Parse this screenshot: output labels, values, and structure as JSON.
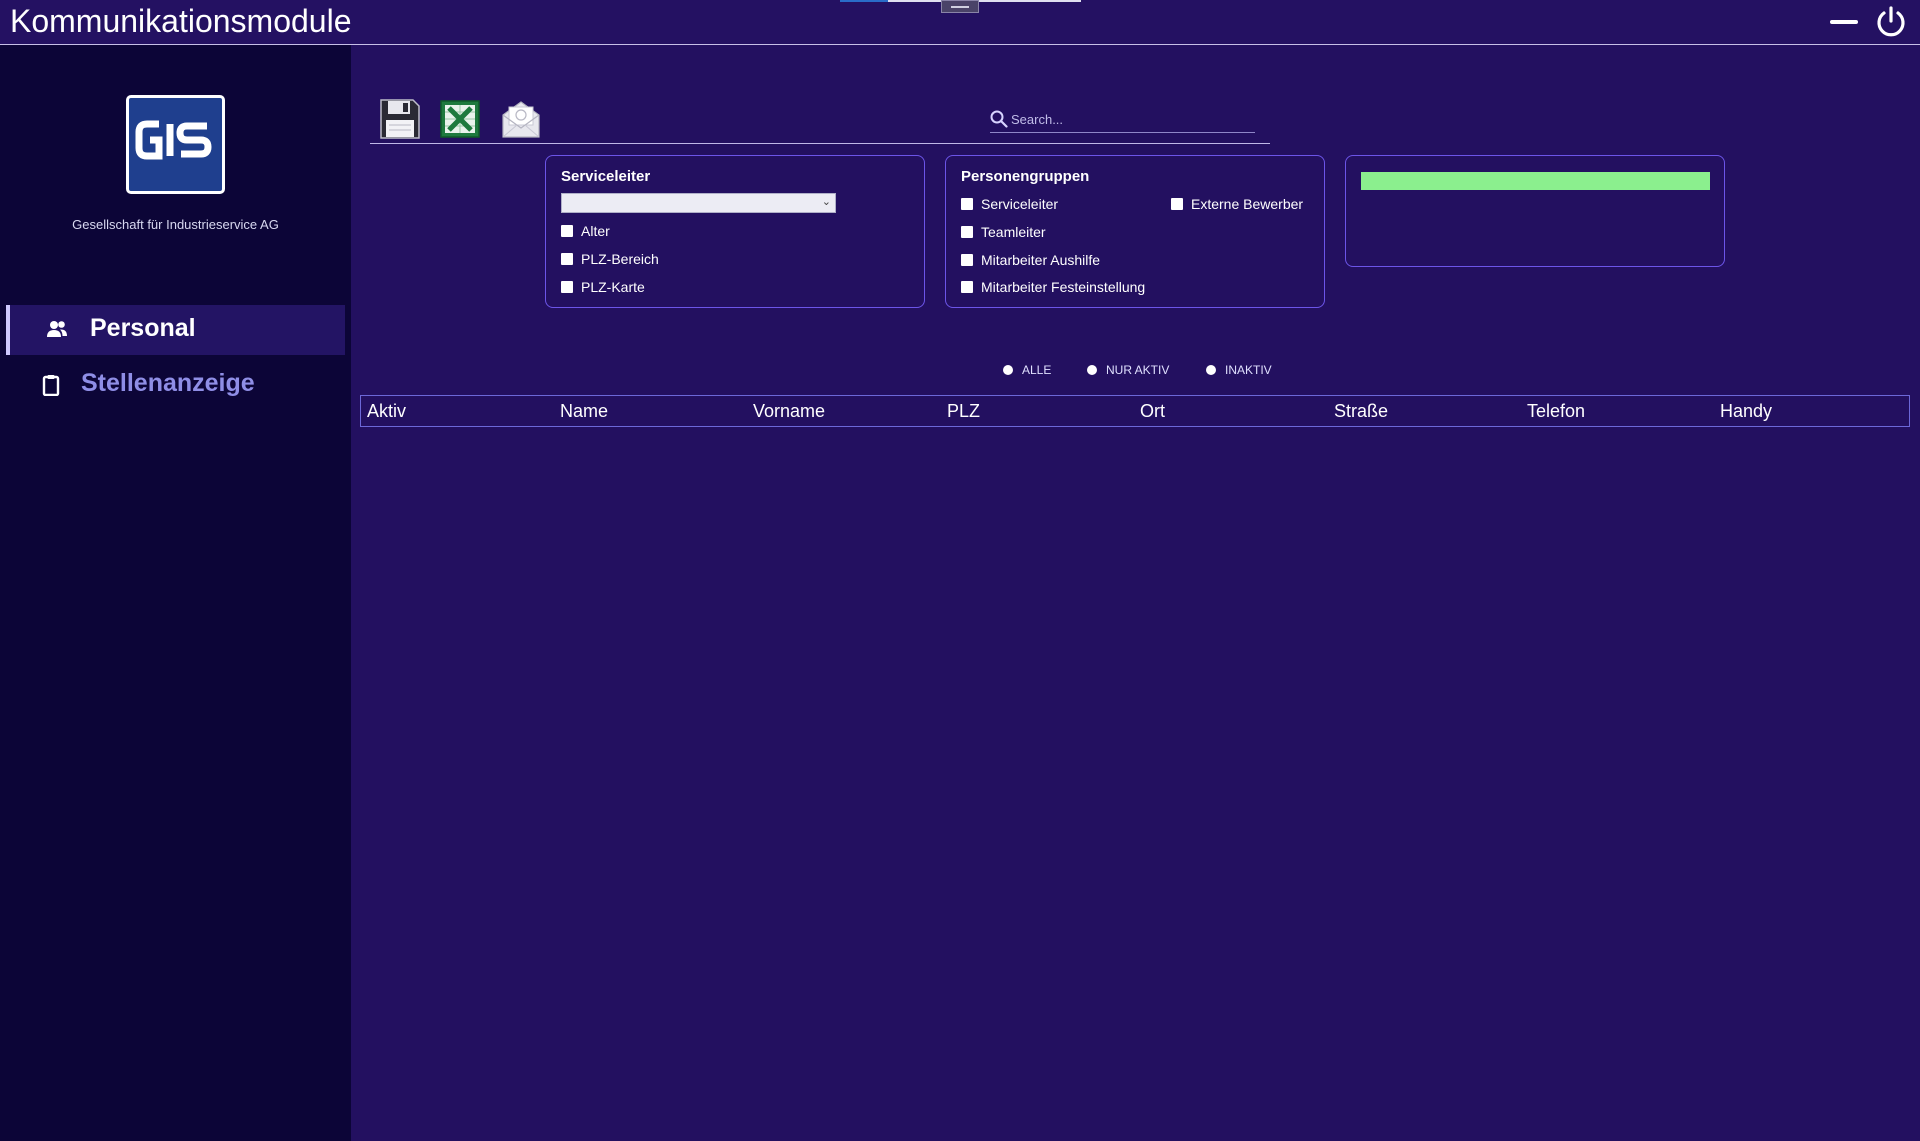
{
  "app": {
    "title": "Kommunikationsmodule"
  },
  "sidebar": {
    "company": "Gesellschaft für Industrieservice AG",
    "items": [
      {
        "label": "Personal",
        "icon": "people-icon",
        "active": true
      },
      {
        "label": "Stellenanzeige",
        "icon": "clipboard-icon",
        "active": false
      }
    ]
  },
  "toolbar": {
    "icons": [
      "save-icon",
      "excel-icon",
      "mail-icon"
    ]
  },
  "search": {
    "placeholder": "Search..."
  },
  "serviceleiter_panel": {
    "title": "Serviceleiter",
    "select_value": "",
    "checkboxes": [
      {
        "label": "Alter",
        "checked": false
      },
      {
        "label": "PLZ-Bereich",
        "checked": false
      },
      {
        "label": "PLZ-Karte",
        "checked": false
      }
    ]
  },
  "personengruppen_panel": {
    "title": "Personengruppen",
    "checkboxes": [
      {
        "label": "Serviceleiter",
        "checked": false
      },
      {
        "label": "Teamleiter",
        "checked": false
      },
      {
        "label": "Mitarbeiter Aushilfe",
        "checked": false
      },
      {
        "label": "Mitarbeiter Festeinstellung",
        "checked": false
      },
      {
        "label": "Externe Bewerber",
        "checked": false
      }
    ]
  },
  "status_panel": {
    "bar_color": "#8bef8e"
  },
  "filter": {
    "options": [
      "ALLE",
      "NUR AKTIV",
      "INAKTIV"
    ]
  },
  "table": {
    "columns": [
      "Aktiv",
      "Name",
      "Vorname",
      "PLZ",
      "Ort",
      "Straße",
      "Telefon",
      "Handy"
    ],
    "rows": []
  },
  "colors": {
    "background": "#231060",
    "sidebar": "#0c0537",
    "accent": "#6c55e8"
  }
}
